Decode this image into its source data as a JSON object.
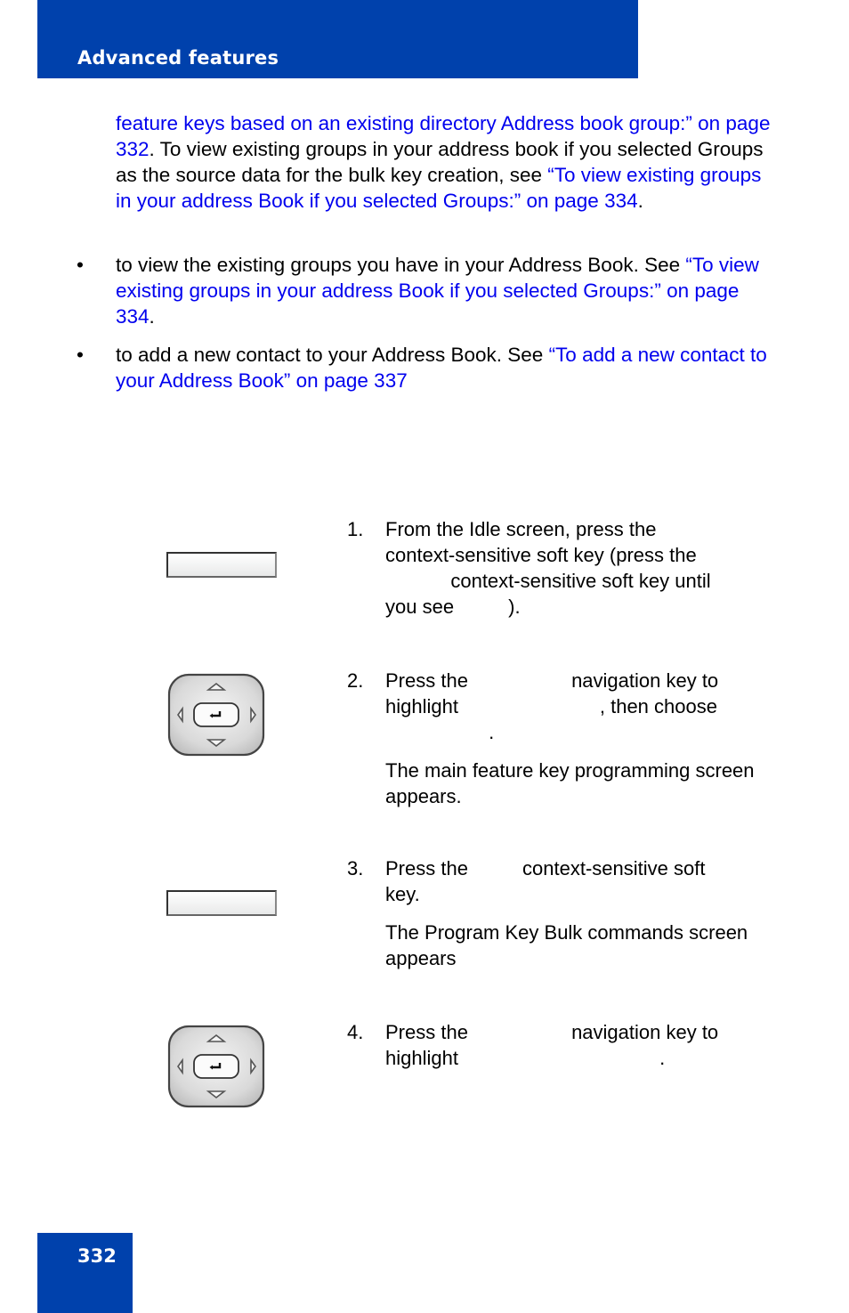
{
  "header": {
    "title": "Advanced features"
  },
  "intro": {
    "segments": [
      {
        "text": "feature keys based on an existing directory Address book group:” on page 332",
        "link": true
      },
      {
        "text": ". To view existing groups in your address book if you selected Groups as the source data for the bulk key creation, see ",
        "link": false
      },
      {
        "text": "“To view existing groups in your address Book if you selected Groups:” on page 334",
        "link": true
      },
      {
        "text": ".",
        "link": false
      }
    ]
  },
  "bullets": [
    {
      "marker": "•",
      "text": "to view the existing groups you have in your Address Book. See ",
      "link": "“To view existing groups in your address Book if you selected Groups:” on page 334",
      "tail": "."
    },
    {
      "marker": "•",
      "text": "to add a new contact to your Address Book. See ",
      "link": "“To add a new contact to your Address Book” on page 337",
      "tail": ""
    }
  ],
  "steps": [
    {
      "number": "1.",
      "lines": [
        "From the Idle screen, press the",
        "context-sensitive soft key (press the",
        "            context-sensitive soft key until",
        "you see          )."
      ],
      "sub": []
    },
    {
      "number": "2.",
      "lines": [
        "Press the                   navigation key to",
        "highlight                          , then choose",
        "                   ."
      ],
      "sub": [
        "The main feature key programming screen appears."
      ]
    },
    {
      "number": "3.",
      "lines": [
        "Press the          context-sensitive soft",
        "key."
      ],
      "sub": [
        "The Program Key Bulk commands screen appears"
      ]
    },
    {
      "number": "4.",
      "lines": [
        "Press the                   navigation key to",
        "highlight                                     ."
      ],
      "sub": []
    }
  ],
  "icons": {
    "softkey": "soft-key-button",
    "navkey": "navigation-cluster"
  },
  "footer": {
    "page_number": "332"
  },
  "colors": {
    "brand_blue": "#0041ac",
    "link_blue": "#0000ee"
  }
}
